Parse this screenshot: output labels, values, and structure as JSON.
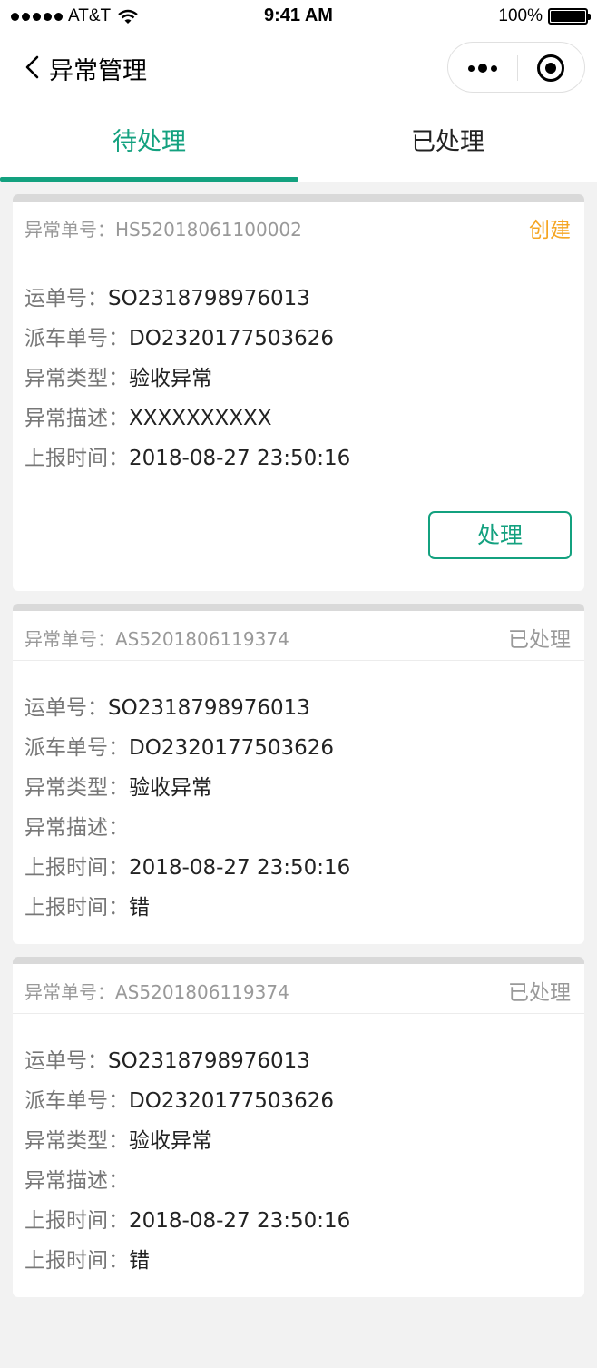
{
  "status_bar": {
    "carrier": "AT&T",
    "time": "9:41 AM",
    "battery": "100%"
  },
  "nav": {
    "title": "异常管理"
  },
  "tabs": [
    {
      "label": "待处理",
      "active": true
    },
    {
      "label": "已处理",
      "active": false
    }
  ],
  "colors": {
    "accent": "#13a17f",
    "pending": "#f5a623",
    "muted": "#999999"
  },
  "cards": [
    {
      "order_label": "异常单号：",
      "order_no": "HS52018061100002",
      "status": "创建",
      "rows": [
        {
          "label": "运单号：",
          "value": "SO2318798976013"
        },
        {
          "label": "派车单号：",
          "value": "DO2320177503626"
        },
        {
          "label": "异常类型：",
          "value": "验收异常"
        },
        {
          "label": "异常描述：",
          "value": "XXXXXXXXXX"
        },
        {
          "label": "上报时间：",
          "value": "2018-08-27 23:50:16"
        }
      ],
      "action": "处理"
    },
    {
      "order_label": "异常单号：",
      "order_no": "AS5201806119374",
      "status": "已处理",
      "rows": [
        {
          "label": "运单号：",
          "value": "SO2318798976013"
        },
        {
          "label": "派车单号：",
          "value": "DO2320177503626"
        },
        {
          "label": "异常类型：",
          "value": "验收异常"
        },
        {
          "label": "异常描述：",
          "value": ""
        },
        {
          "label": "上报时间：",
          "value": "2018-08-27 23:50:16"
        },
        {
          "label": "上报时间：",
          "value": "错"
        }
      ]
    },
    {
      "order_label": "异常单号：",
      "order_no": "AS5201806119374",
      "status": "已处理",
      "rows": [
        {
          "label": "运单号：",
          "value": "SO2318798976013"
        },
        {
          "label": "派车单号：",
          "value": "DO2320177503626"
        },
        {
          "label": "异常类型：",
          "value": "验收异常"
        },
        {
          "label": "异常描述：",
          "value": ""
        },
        {
          "label": "上报时间：",
          "value": "2018-08-27 23:50:16"
        },
        {
          "label": "上报时间：",
          "value": "错"
        }
      ]
    }
  ]
}
